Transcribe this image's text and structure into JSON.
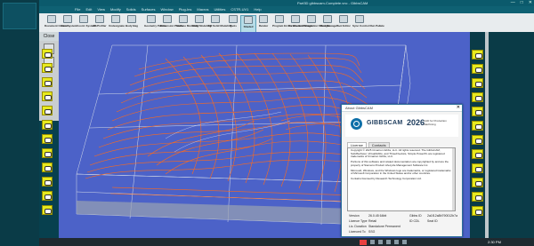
{
  "window": {
    "title": "Part3D gibbscam-Complete.vnc - GibbsCAM",
    "controls": [
      "—",
      "□",
      "✕"
    ]
  },
  "menu": [
    "File",
    "Edit",
    "View",
    "Modify",
    "Solids",
    "Surfaces",
    "Window",
    "Plug-Ins",
    "Macros",
    "Utilities",
    "CSTR-UV1",
    "Help"
  ],
  "ribbon": [
    {
      "label": "Document Control..."
    },
    {
      "label": "View System"
    },
    {
      "label": "Coord. Systems"
    },
    {
      "label": "2D Profiler"
    },
    {
      "label": "Undesignate"
    },
    {
      "label": "Body Bag"
    },
    {
      "label": "Geometry Palette"
    },
    {
      "label": "Dimension Palette"
    },
    {
      "label": "Surface Modeling"
    },
    {
      "label": "Solid Modeling"
    },
    {
      "label": "Fill Solid Modeling"
    },
    {
      "label": "Tools"
    },
    {
      "label": "Shaded"
    },
    {
      "label": "Render"
    },
    {
      "label": "Program Errors Checker"
    },
    {
      "label": "Parameter Manager"
    },
    {
      "label": "Simulation Manager..."
    },
    {
      "label": "Tool Manager..."
    },
    {
      "label": "Tool Editor"
    },
    {
      "label": "Sync Control Run Pallete"
    }
  ],
  "left": {
    "close_label": "Close"
  },
  "about": {
    "title": "About GibbsCAM",
    "brand": "GIBBSCAM",
    "year": "2026",
    "tagline": "CAD for Production Machining",
    "tabs": [
      "License",
      "Contacts"
    ],
    "license_paragraphs": [
      "Copyright © 2025 Cimatron Gibbs, LLC. All rights reserved. The GibbsCAM, SolidSurfacer, VirtualGibbs, and ThreeFiveAxis, Simple PowerPo are registered trademarks of Cimatron Gibbs, LLC.",
      "Portions of this software and related documentation are copyrighted by and are the property of Siemens Product Lifecycle Management Software Inc.",
      "Microsoft, Windows, and the Windows logo are trademarks, or registered trademarks of Microsoft Corporation in the United States and/or other countries.",
      "Contains licensed by Research Technology Corporation Ltd."
    ],
    "info": [
      {
        "k": "Version",
        "v": "26.0.45 64bit",
        "k2": "Gibbs ID",
        "v2": "2a1f12a8b790012b7a"
      },
      {
        "k": "Licence Type",
        "v": "Retail",
        "k2": "ID CDL",
        "v2": "Seat ID"
      },
      {
        "k": "Lic. Duration",
        "v": "Standalone Permanent",
        "k2": "",
        "v2": ""
      },
      {
        "k": "Licenced To",
        "v": "SSG",
        "k2": "",
        "v2": ""
      }
    ]
  },
  "status": {
    "clock": "2:30 PM"
  },
  "colors": {
    "canvas_bg": "#4c62c8",
    "toolpath": "#ff6a1a",
    "wireframe": "#d6dce8",
    "accent": "#0e6fa8"
  }
}
